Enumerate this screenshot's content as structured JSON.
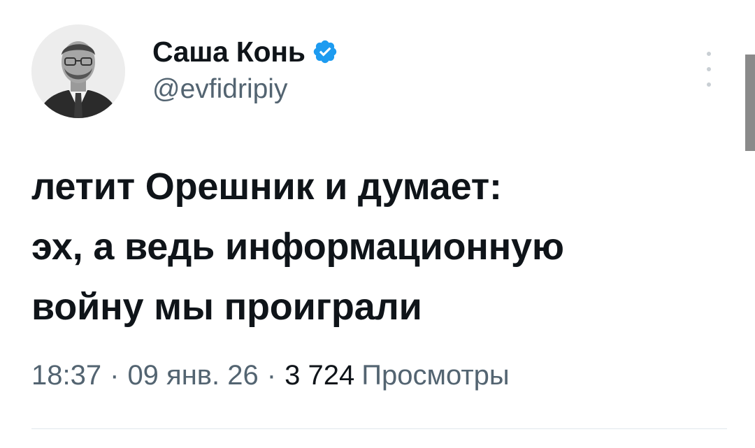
{
  "author": {
    "display_name": "Саша Конь",
    "handle": "@evfidripiy",
    "verified": true
  },
  "tweet": {
    "lines": [
      "летит Орешник и думает:",
      "эх, а ведь информационную",
      "войну мы проиграли"
    ]
  },
  "meta": {
    "time": "18:37",
    "separator": "·",
    "date": "09 янв. 26",
    "views_count": "3 724",
    "views_label": "Просмотры"
  },
  "icons": {
    "verified": "verified-badge-icon",
    "more": "more-vertical-icon"
  },
  "colors": {
    "verified_blue": "#1d9bf0",
    "secondary_text": "#536471",
    "primary_text": "#0f1419"
  }
}
